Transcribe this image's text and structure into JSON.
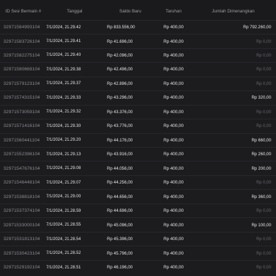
{
  "colors": {
    "background": "#1c1c1f",
    "header_background": "#1a1a1d",
    "header_text": "#9d9da2",
    "text": "#e6e6e8",
    "id_text": "#8a8a8f",
    "muted": "#66666b",
    "divider": "#28282c"
  },
  "table": {
    "columns": [
      "ID Sesi Bermain #",
      "Tanggal",
      "Saldo Baru",
      "Taruhan",
      "Jumlah Dimenangkan"
    ],
    "rows": [
      {
        "id": "32971584993104",
        "date": "7/1/2024, 21.29.42",
        "balance": "Rp 833.556,00",
        "bet": "Rp 400,00",
        "win": "Rp 792.260,00"
      },
      {
        "id": "32971583726104",
        "date": "7/1/2024, 21.29.41",
        "balance": "Rp 41.696,00",
        "bet": "Rp 400,00",
        "win": "Rp 0,00"
      },
      {
        "id": "32971582275104",
        "date": "7/1/2024, 21.29.40",
        "balance": "Rp 42.096,00",
        "bet": "Rp 400,00",
        "win": "Rp 0,00"
      },
      {
        "id": "32971580669104",
        "date": "7/1/2024, 21.29.38",
        "balance": "Rp 42.496,00",
        "bet": "Rp 400,00",
        "win": "Rp 0,00"
      },
      {
        "id": "32971579123104",
        "date": "7/1/2024, 21.29.37",
        "balance": "Rp 42.896,00",
        "bet": "Rp 400,00",
        "win": "Rp 0,00"
      },
      {
        "id": "32971574315104",
        "date": "7/1/2024, 21.29.33",
        "balance": "Rp 43.296,00",
        "bet": "Rp 400,00",
        "win": "Rp 320,00"
      },
      {
        "id": "32971573059104",
        "date": "7/1/2024, 21.29.32",
        "balance": "Rp 43.376,00",
        "bet": "Rp 400,00",
        "win": "Rp 0,00"
      },
      {
        "id": "32971571416104",
        "date": "7/1/2024, 21.29.30",
        "balance": "Rp 43.776,00",
        "bet": "Rp 400,00",
        "win": "Rp 0,00"
      },
      {
        "id": "32971560441104",
        "date": "7/1/2024, 21.29.20",
        "balance": "Rp 44.176,00",
        "bet": "Rp 400,00",
        "win": "Rp 660,00"
      },
      {
        "id": "32971552398104",
        "date": "7/1/2024, 21.29.13",
        "balance": "Rp 43.916,00",
        "bet": "Rp 400,00",
        "win": "Rp 260,00"
      },
      {
        "id": "32971547676104",
        "date": "7/1/2024, 21.29.08",
        "balance": "Rp 44.056,00",
        "bet": "Rp 400,00",
        "win": "Rp 200,00"
      },
      {
        "id": "32971546448104",
        "date": "7/1/2024, 21.29.07",
        "balance": "Rp 44.256,00",
        "bet": "Rp 400,00",
        "win": "Rp 0,00"
      },
      {
        "id": "32971538818104",
        "date": "7/1/2024, 21.29.00",
        "balance": "Rp 44.656,00",
        "bet": "Rp 400,00",
        "win": "Rp 360,00"
      },
      {
        "id": "32971537374104",
        "date": "7/1/2024, 21.28.59",
        "balance": "Rp 44.696,00",
        "bet": "Rp 400,00",
        "win": "Rp 0,00"
      },
      {
        "id": "32971533000104",
        "date": "7/1/2024, 21.28.55",
        "balance": "Rp 45.096,00",
        "bet": "Rp 400,00",
        "win": "Rp 100,00"
      },
      {
        "id": "32971531813104",
        "date": "7/1/2024, 21.28.54",
        "balance": "Rp 45.396,00",
        "bet": "Rp 400,00",
        "win": "Rp 0,00"
      },
      {
        "id": "32971530423104",
        "date": "7/1/2024, 21.28.52",
        "balance": "Rp 45.796,00",
        "bet": "Rp 400,00",
        "win": "Rp 0,00"
      },
      {
        "id": "32971529192104",
        "date": "7/1/2024, 21.28.51",
        "balance": "Rp 46.196,00",
        "bet": "Rp 400,00",
        "win": "Rp 0,00"
      }
    ]
  }
}
